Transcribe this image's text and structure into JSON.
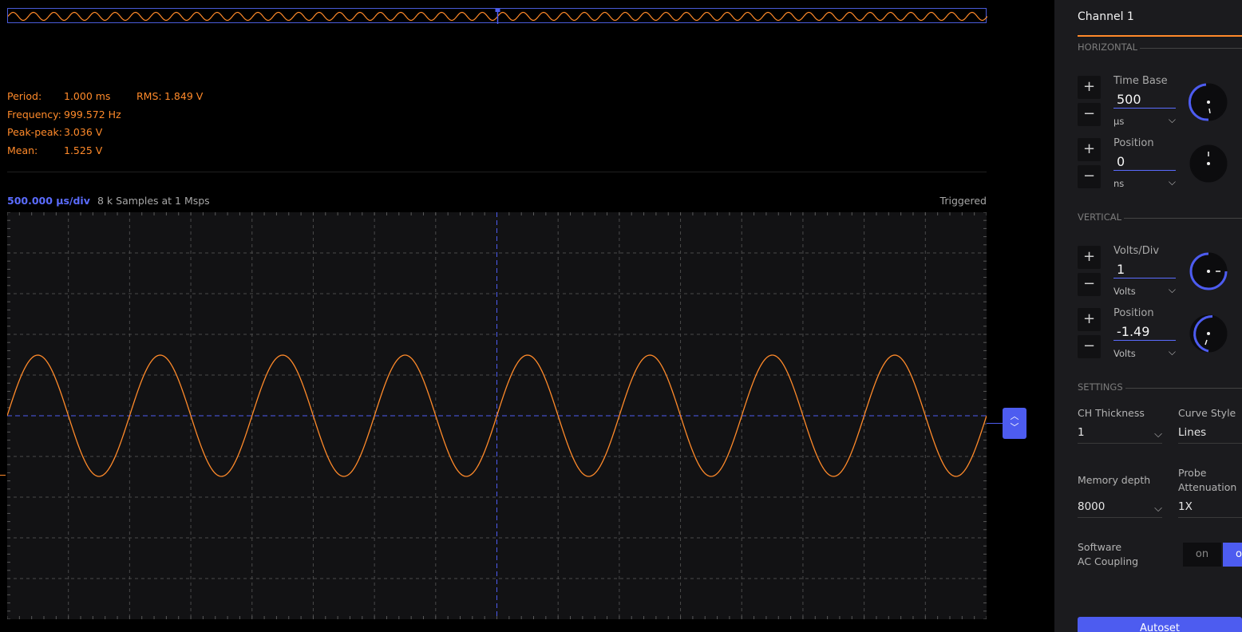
{
  "measurements": {
    "period_label": "Period:",
    "period_value": "1.000 ms",
    "rms_label": "RMS:",
    "rms_value": "1.849 V",
    "frequency_label": "Frequency:",
    "frequency_value": "999.572 Hz",
    "peak_label": "Peak-peak:",
    "peak_value": "3.036 V",
    "mean_label": "Mean:",
    "mean_value": "1.525 V"
  },
  "plot_info": {
    "time_div": "500.000 μs/div",
    "samples": "8 k Samples at 1 Msps",
    "status": "Triggered"
  },
  "trigger_marker": {
    "up": "︿",
    "down": "﹀"
  },
  "colors": {
    "signal": "#ff8a2a",
    "accent": "#4d5cf0",
    "grid": "#4a4a4a"
  },
  "chart_data": {
    "type": "line",
    "title": "",
    "xlabel": "",
    "ylabel": "",
    "divisions_x": 16,
    "divisions_y": 10,
    "xlim_ms": [
      -4.0,
      4.0
    ],
    "ylim_div": [
      -5,
      5
    ],
    "grid": true,
    "series": [
      {
        "waveform": "sine",
        "frequency_hz": 999.572,
        "offset_div": 0.0,
        "amplitude_div": 1.49,
        "period_ms": 1.0
      }
    ]
  },
  "panel": {
    "channel_title": "Channel 1",
    "horizontal_header": "HORIZONTAL",
    "vertical_header": "VERTICAL",
    "settings_header": "SETTINGS",
    "plus": "+",
    "minus": "−",
    "chevron": "⌵",
    "time_base": {
      "label": "Time Base",
      "value": "500",
      "unit": "μs"
    },
    "h_position": {
      "label": "Position",
      "value": "0",
      "unit": "ns"
    },
    "volts_div": {
      "label": "Volts/Div",
      "value": "1",
      "unit": "Volts"
    },
    "v_position": {
      "label": "Position",
      "value": "-1.49",
      "unit": "Volts"
    },
    "ch_thickness": {
      "label": "CH Thickness",
      "value": "1"
    },
    "curve_style": {
      "label": "Curve Style",
      "value": "Lines"
    },
    "memory_depth": {
      "label": "Memory depth",
      "value": "8000"
    },
    "probe_attenuation": {
      "label": "Probe Attenuation",
      "value": "1X"
    },
    "ac_coupling": {
      "label_line1": "Software",
      "label_line2": "AC Coupling",
      "on": "on",
      "off": "off"
    },
    "autoset": "Autoset"
  }
}
